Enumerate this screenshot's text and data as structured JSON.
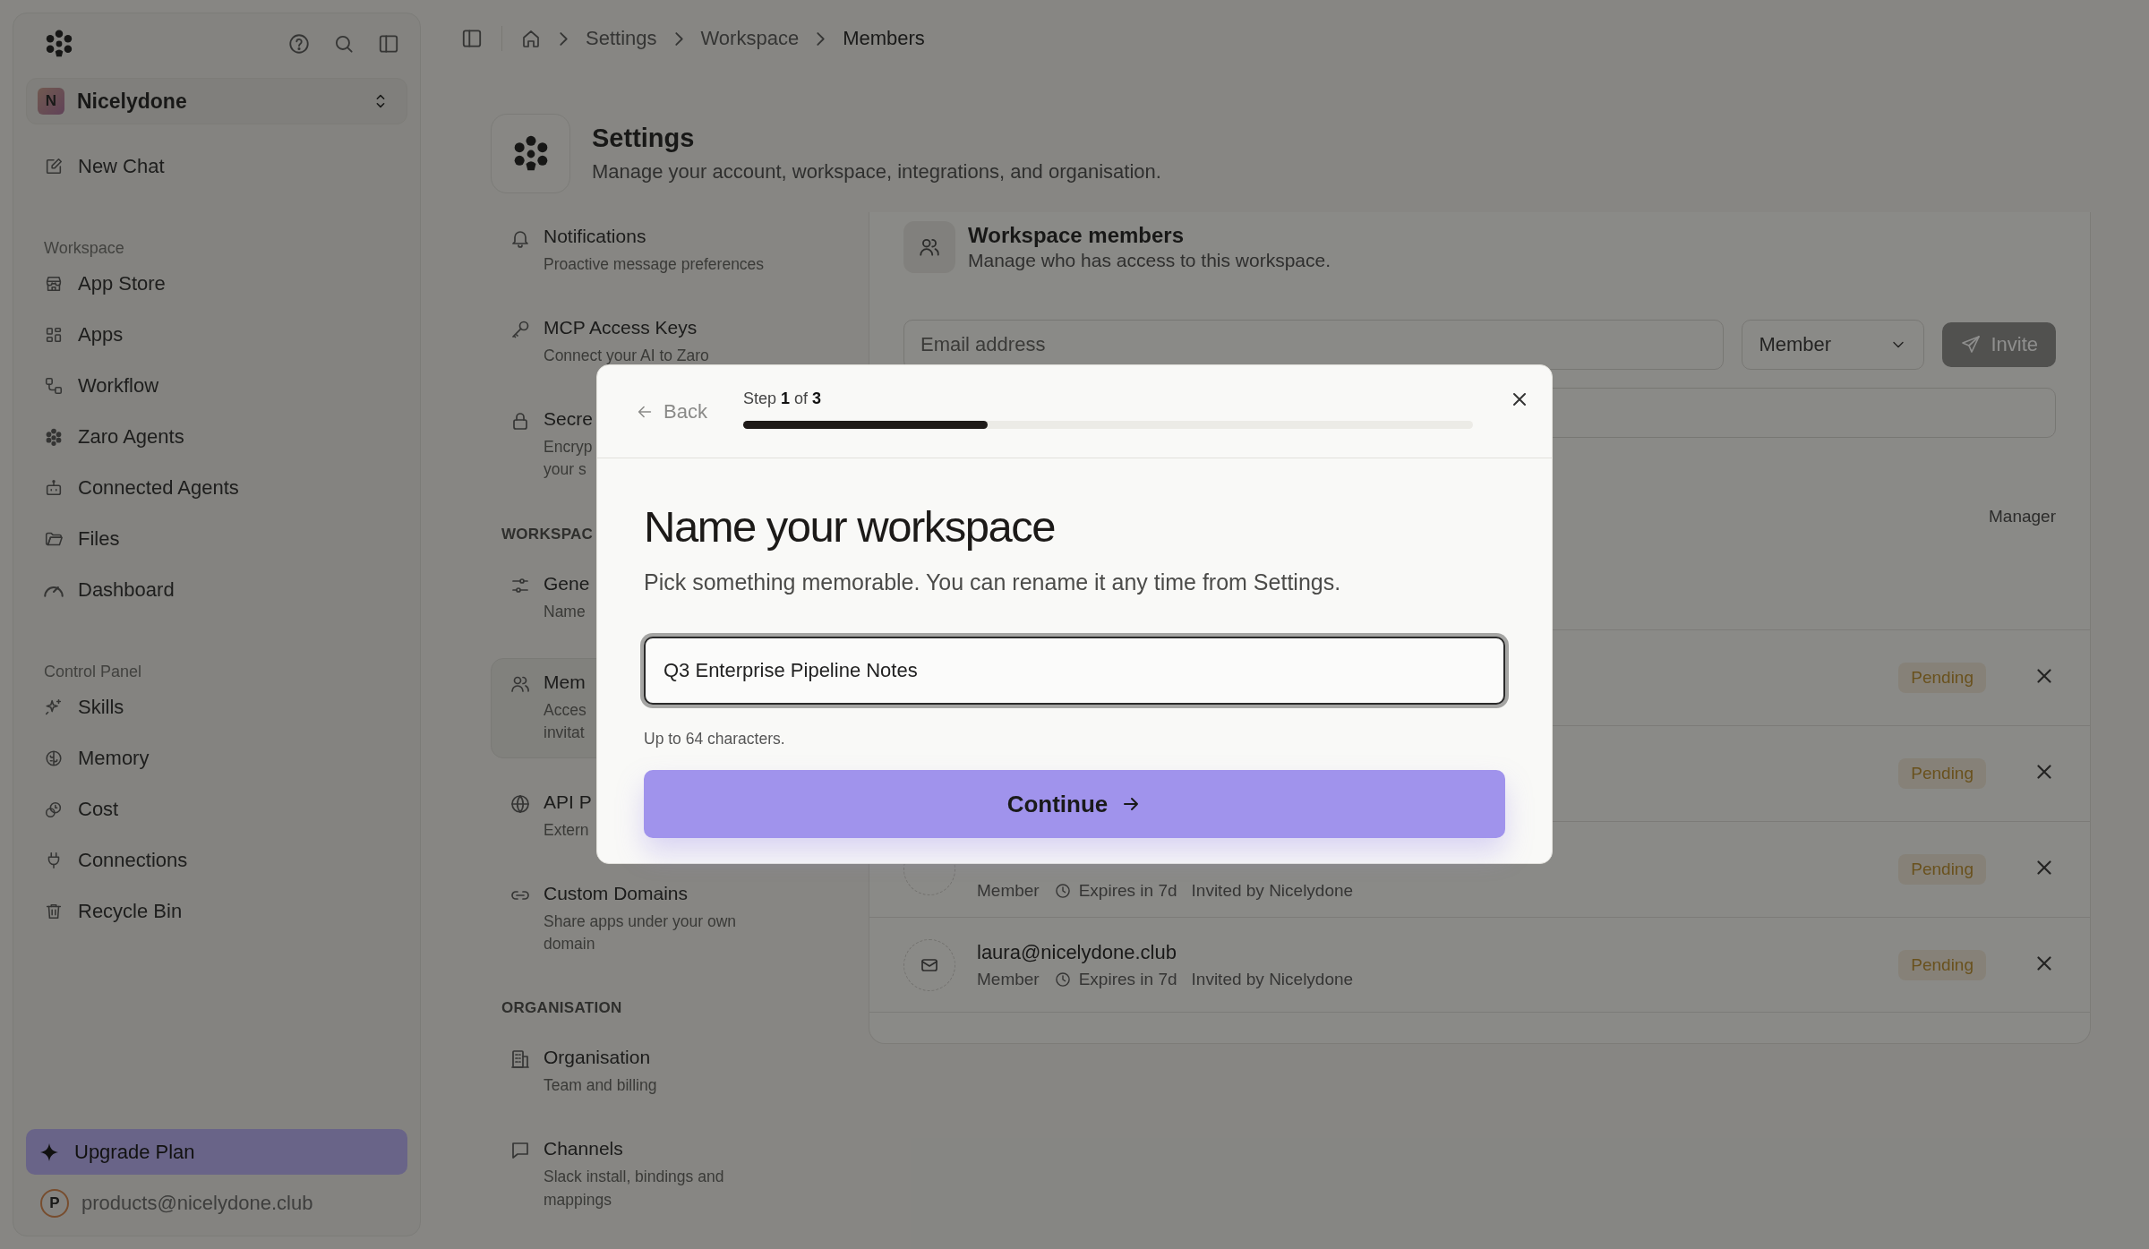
{
  "sidebar": {
    "workspace": {
      "initial": "N",
      "name": "Nicelydone"
    },
    "new_chat": "New Chat",
    "sections": [
      {
        "label": "Workspace",
        "items": [
          {
            "label": "App Store"
          },
          {
            "label": "Apps"
          },
          {
            "label": "Workflow"
          },
          {
            "label": "Zaro Agents"
          },
          {
            "label": "Connected Agents"
          },
          {
            "label": "Files"
          },
          {
            "label": "Dashboard"
          }
        ]
      },
      {
        "label": "Control Panel",
        "items": [
          {
            "label": "Skills"
          },
          {
            "label": "Memory"
          },
          {
            "label": "Cost"
          },
          {
            "label": "Connections"
          },
          {
            "label": "Recycle Bin"
          }
        ]
      }
    ],
    "upgrade": "Upgrade Plan",
    "account": {
      "initial": "P",
      "email": "products@nicelydone.club"
    }
  },
  "breadcrumb": [
    "Settings",
    "Workspace",
    "Members"
  ],
  "settings_header": {
    "title": "Settings",
    "subtitle": "Manage your account, workspace, integrations, and organisation."
  },
  "settings_nav": {
    "groups": [
      {
        "items": [
          {
            "title": "Notifications",
            "subtitle": "Proactive message preferences",
            "selected": false
          },
          {
            "title": "MCP Access Keys",
            "subtitle": "Connect your AI to Zaro",
            "selected": false
          },
          {
            "title": "Secre",
            "subtitle": "Encryp\nyour s",
            "selected": false
          }
        ]
      },
      {
        "label": "WORKSPAC",
        "items": [
          {
            "title": "Gene",
            "subtitle": "Name",
            "selected": false
          },
          {
            "title": "Mem",
            "subtitle": "Acces\ninvitat",
            "selected": true
          },
          {
            "title": "API P",
            "subtitle": "Extern",
            "selected": false
          },
          {
            "title": "Custom Domains",
            "subtitle": "Share apps under your own\ndomain",
            "selected": false
          }
        ]
      },
      {
        "label": "ORGANISATION",
        "items": [
          {
            "title": "Organisation",
            "subtitle": "Team and billing",
            "selected": false
          },
          {
            "title": "Channels",
            "subtitle": "Slack install, bindings and\nmappings",
            "selected": false
          }
        ]
      }
    ]
  },
  "members_panel": {
    "title": "Workspace members",
    "subtitle": "Manage who has access to this workspace.",
    "email_placeholder": "Email address",
    "role": "Member",
    "invite": {
      "label": "Invite",
      "disabled": true
    },
    "manager_role": "Manager",
    "rows": [
      {
        "status": "Pending"
      },
      {
        "status": "Pending"
      },
      {
        "role": "Member",
        "expires": "Expires in 7d",
        "invited_by": "Invited by Nicelydone",
        "status": "Pending"
      },
      {
        "email": "laura@nicelydone.club",
        "role": "Member",
        "expires": "Expires in 7d",
        "invited_by": "Invited by Nicelydone",
        "status": "Pending"
      }
    ]
  },
  "modal": {
    "back": "Back",
    "step": "Step **1** of **3**",
    "progress": {
      "level": 0.335
    },
    "title": "Name your workspace",
    "subtitle": "Pick something memorable. You can rename it any time from Settings.",
    "value": "Q3 Enterprise Pipeline Notes",
    "helper": "Up to 64 characters.",
    "continue": "Continue"
  }
}
